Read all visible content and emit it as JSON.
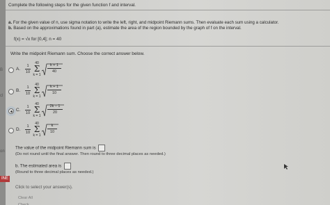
{
  "header": {
    "instruction": "Complete the following steps for the given function f and interval."
  },
  "steps": {
    "a_label": "a.",
    "a_text": "For the given value of n, use sigma notation to write the left, right, and midpoint Riemann sums. Then evaluate each sum using a calculator.",
    "b_label": "b.",
    "b_text": "Based on the approximations found in part (a), estimate the area of the region bounded by the graph of f on the interval."
  },
  "function_def": "f(x) = √x for [0,4]; n = 40",
  "prompt": "Write the midpoint Riemann sum. Choose the correct answer below.",
  "options": [
    {
      "letter": "A.",
      "coef_num": "1",
      "coef_den": "10",
      "upper": "40",
      "lower": "k = 1",
      "rad_num": "k + 1",
      "rad_den": "40",
      "selected": false
    },
    {
      "letter": "B.",
      "coef_num": "1",
      "coef_den": "10",
      "upper": "40",
      "lower": "k = 1",
      "rad_num": "k + 1",
      "rad_den": "10",
      "selected": false
    },
    {
      "letter": "C.",
      "coef_num": "1",
      "coef_den": "10",
      "upper": "40",
      "lower": "k = 1",
      "rad_num": "2k − 1",
      "rad_den": "20",
      "selected": true
    },
    {
      "letter": "D.",
      "coef_num": "1",
      "coef_den": "10",
      "upper": "40",
      "lower": "k = 1",
      "rad_num": "k",
      "rad_den": "10",
      "selected": false
    }
  ],
  "midpoint_value": {
    "label": "The value of the midpoint Riemann sum is",
    "value": "",
    "note": "(Do not round until the final answer. Then round to three decimal places as needed.)"
  },
  "estimate": {
    "label": "b. The estimated area is",
    "value": "",
    "note": "(Round to three decimal places as needed.)"
  },
  "help_text": "Click to select your answer(s).",
  "clear_label": "Clear All Check",
  "side": {
    "label_1": "B",
    "label_2": "cl",
    "label_3": "on",
    "badge": "INE"
  },
  "colors": {
    "selected_radio": "#b9c2c9",
    "badge": "#b23a3a"
  }
}
